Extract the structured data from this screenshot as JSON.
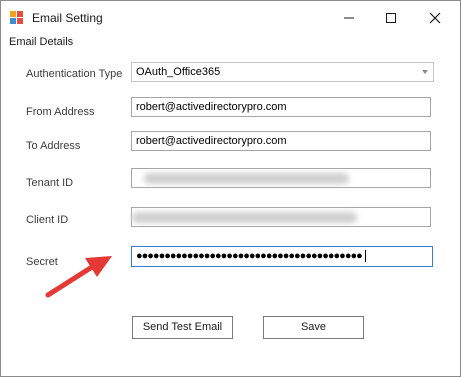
{
  "window": {
    "title": "Email Setting"
  },
  "group": {
    "label": "Email Details"
  },
  "form": {
    "auth_type_label": "Authentication Type",
    "auth_type_value": "OAuth_Office365",
    "from_label": "From Address",
    "from_value": "robert@activedirectorypro.com",
    "to_label": "To Address",
    "to_value": "robert@activedirectorypro.com",
    "tenant_label": "Tenant ID",
    "client_label": "Client ID",
    "secret_label": "Secret",
    "secret_value": "●●●●●●●●●●●●●●●●●●●●●●●●●●●●●●●●●●●●●●●●"
  },
  "buttons": {
    "send_test": "Send Test Email",
    "save": "Save"
  },
  "colors": {
    "annotation_arrow": "#e53935",
    "focus_border": "#3a7bd5"
  }
}
